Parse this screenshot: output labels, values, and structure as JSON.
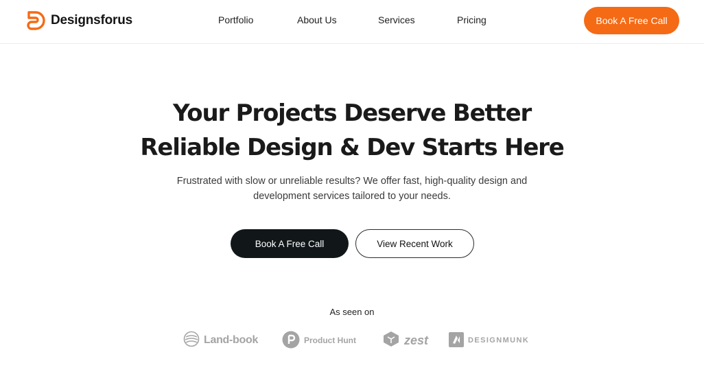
{
  "header": {
    "brand_name": "Designsforus",
    "brand_color": "#f56a14",
    "nav": [
      {
        "label": "Portfolio"
      },
      {
        "label": "About Us"
      },
      {
        "label": "Services"
      },
      {
        "label": "Pricing"
      }
    ],
    "cta_label": "Book A Free Call"
  },
  "hero": {
    "title_line1": "Your Projects Deserve Better",
    "title_line2": "Reliable Design & Dev Starts Here",
    "subtitle_line1": "Frustrated with slow or unreliable results? We offer fast, high-quality design and",
    "subtitle_line2": "development services tailored to your needs.",
    "primary_button": "Book A Free Call",
    "secondary_button": "View Recent Work",
    "primary_button_color": "#111719"
  },
  "seen_on": {
    "label": "As seen on",
    "logos": [
      {
        "name": "Land-book",
        "icon": "land-book-icon"
      },
      {
        "name": "Product Hunt",
        "icon": "product-hunt-icon"
      },
      {
        "name": "zest",
        "icon": "zest-icon"
      },
      {
        "name": "DESIGNMUNK",
        "icon": "designmunk-icon"
      }
    ]
  }
}
